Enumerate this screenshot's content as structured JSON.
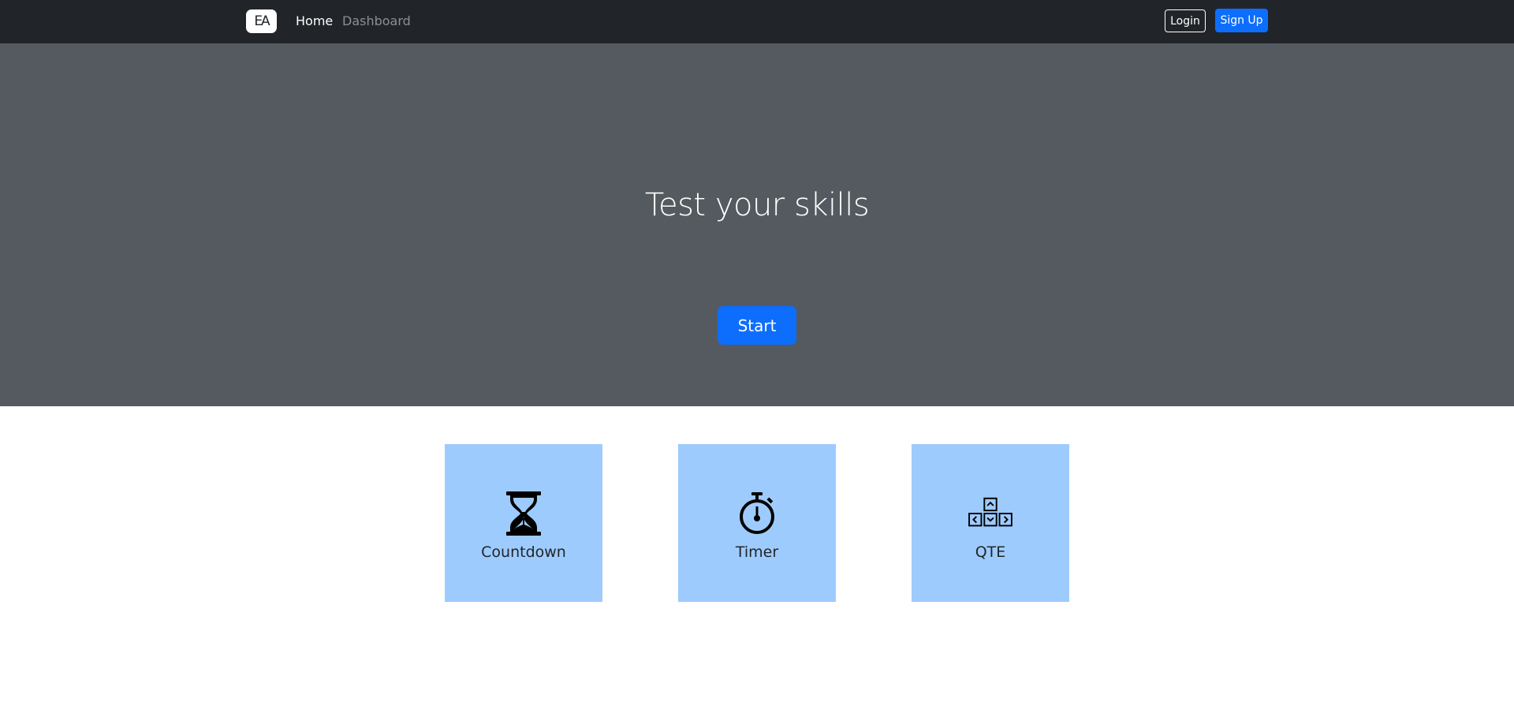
{
  "navbar": {
    "brand": "EA",
    "links": [
      "Home",
      "Dashboard"
    ],
    "login_label": "Login",
    "signup_label": "Sign Up"
  },
  "hero": {
    "title": "Test your skills",
    "start_label": "Start"
  },
  "cards": [
    {
      "label": "Countdown",
      "icon": "hourglass-icon"
    },
    {
      "label": "Timer",
      "icon": "stopwatch-icon"
    },
    {
      "label": "QTE",
      "icon": "arrow-keys-icon"
    }
  ],
  "colors": {
    "navbar_bg": "#212529",
    "hero_bg": "#545a60",
    "primary": "#0d6efd",
    "card_bg": "#9ecbfe"
  }
}
